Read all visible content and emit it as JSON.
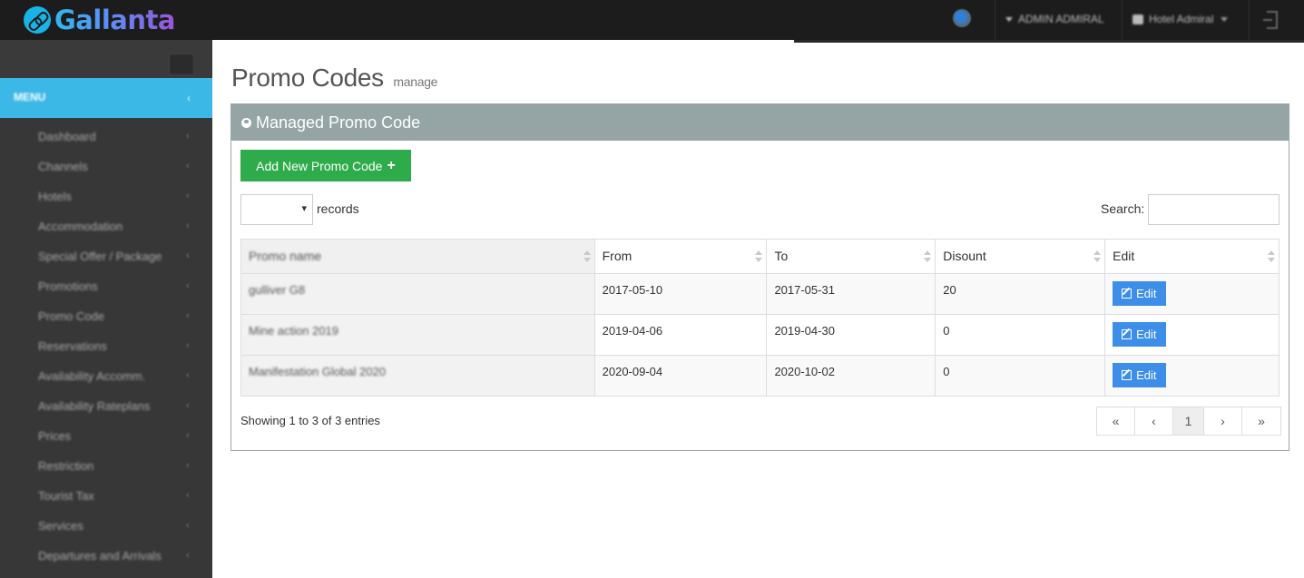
{
  "brand": {
    "name": "Gallanta"
  },
  "topbar": {
    "notifications_icon": "globe-icon",
    "user_label": "ADMIN ADMIRAL",
    "hotel_label": "Hotel Admiral",
    "logout_icon": "logout-icon"
  },
  "sidebar": {
    "menu_title": "MENU",
    "items": [
      {
        "label": "Dashboard"
      },
      {
        "label": "Channels"
      },
      {
        "label": "Hotels"
      },
      {
        "label": "Accommodation"
      },
      {
        "label": "Special Offer / Package"
      },
      {
        "label": "Promotions"
      },
      {
        "label": "Promo Code"
      },
      {
        "label": "Reservations"
      },
      {
        "label": "Availability Accomm."
      },
      {
        "label": "Availability Rateplans"
      },
      {
        "label": "Prices"
      },
      {
        "label": "Restriction"
      },
      {
        "label": "Tourist Tax"
      },
      {
        "label": "Services"
      },
      {
        "label": "Departures and Arrivals"
      }
    ]
  },
  "page": {
    "title": "Promo Codes",
    "subtitle": "manage"
  },
  "panel": {
    "title": "Managed Promo Code",
    "add_button": "Add New Promo Code",
    "records_label": "records",
    "length_value": "",
    "search_label": "Search:",
    "search_value": ""
  },
  "table": {
    "headers": [
      "Promo name",
      "From",
      "To",
      "Disount",
      "Edit"
    ],
    "rows": [
      {
        "name": "gulliver G8",
        "from": "2017-05-10",
        "to": "2017-05-31",
        "discount": "20",
        "edit": "Edit"
      },
      {
        "name": "Mine action 2019",
        "from": "2019-04-06",
        "to": "2019-04-30",
        "discount": "0",
        "edit": "Edit"
      },
      {
        "name": "Manifestation Global 2020",
        "from": "2020-09-04",
        "to": "2020-10-02",
        "discount": "0",
        "edit": "Edit"
      }
    ]
  },
  "footer": {
    "info": "Showing 1 to 3 of 3 entries",
    "pager": {
      "first": "«",
      "prev": "‹",
      "current": "1",
      "next": "›",
      "last": "»"
    }
  },
  "colors": {
    "topbar": "#1c1c1c",
    "sidebar": "#373737",
    "menu_accent": "#3cb8e7",
    "panel_header": "#95a5a6",
    "add_button": "#2eab4a",
    "edit_button": "#3d8ee8"
  }
}
